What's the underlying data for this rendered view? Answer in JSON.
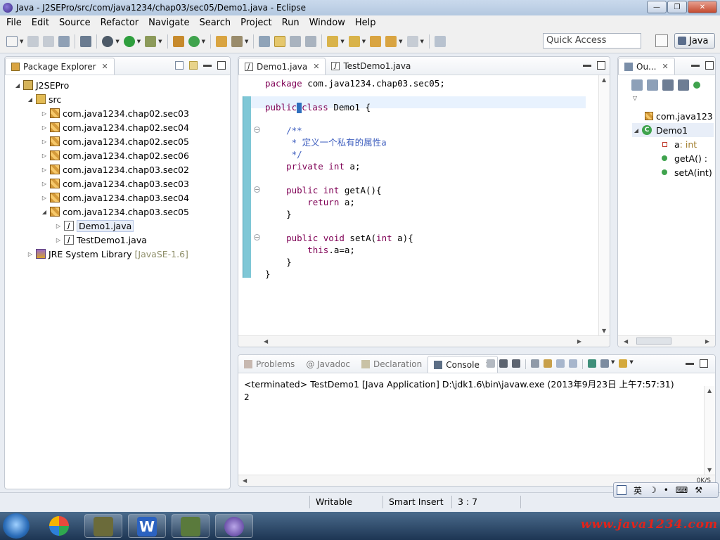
{
  "window": {
    "title": "Java - J2SEPro/src/com/java1234/chap03/sec05/Demo1.java - Eclipse"
  },
  "menu": [
    "File",
    "Edit",
    "Source",
    "Refactor",
    "Navigate",
    "Search",
    "Project",
    "Run",
    "Window",
    "Help"
  ],
  "toolbar": {
    "quick_access": "Quick Access",
    "perspective": "Java"
  },
  "package_explorer": {
    "tab": "Package Explorer",
    "project": "J2SEPro",
    "src": "src",
    "packages": [
      "com.java1234.chap02.sec03",
      "com.java1234.chap02.sec04",
      "com.java1234.chap02.sec05",
      "com.java1234.chap02.sec06",
      "com.java1234.chap03.sec02",
      "com.java1234.chap03.sec03",
      "com.java1234.chap03.sec04",
      "com.java1234.chap03.sec05"
    ],
    "files": [
      "Demo1.java",
      "TestDemo1.java"
    ],
    "jre": "JRE System Library",
    "jre_version": "[JavaSE-1.6]"
  },
  "editor": {
    "tabs": [
      "Demo1.java",
      "TestDemo1.java"
    ],
    "lines": {
      "l1_kw": "package",
      "l1_rest": " com.java1234.chap03.sec05;",
      "l3_kw1": "public",
      "l3_kw2": "class",
      "l3_rest": " Demo1 {",
      "l5": "    /**",
      "l6": "     * 定义一个私有的属性a",
      "l7": "     */",
      "l8_kw": "    private int",
      "l8_rest": " a;",
      "l10_kw": "    public int",
      "l10_rest": " getA(){",
      "l11_kw": "        return",
      "l11_rest": " a;",
      "l12": "    }",
      "l14_kw": "    public void",
      "l14_rest": " setA(",
      "l14_kw2": "int",
      "l14_rest2": " a){",
      "l15_kw": "        this",
      "l15_rest": ".a=a;",
      "l16": "    }",
      "l17": "}"
    }
  },
  "outline": {
    "tab": "Ou...",
    "package": "com.java123",
    "class": "Demo1",
    "field_name": "a",
    "field_type": " : int",
    "method1": "getA() :",
    "method2": "setA(int)"
  },
  "bottom": {
    "tabs": [
      "Problems",
      "@ Javadoc",
      "Declaration",
      "Console"
    ],
    "terminated": "<terminated> TestDemo1 [Java Application] D:\\jdk1.6\\bin\\javaw.exe (2013年9月23日 上午7:57:31)",
    "output": "2",
    "speed": "0K/S"
  },
  "status": {
    "writable": "Writable",
    "insert": "Smart Insert",
    "position": "3 : 7"
  },
  "ime": {
    "mode": "英"
  },
  "taskbar": {
    "watermark": "www.java1234.com"
  }
}
